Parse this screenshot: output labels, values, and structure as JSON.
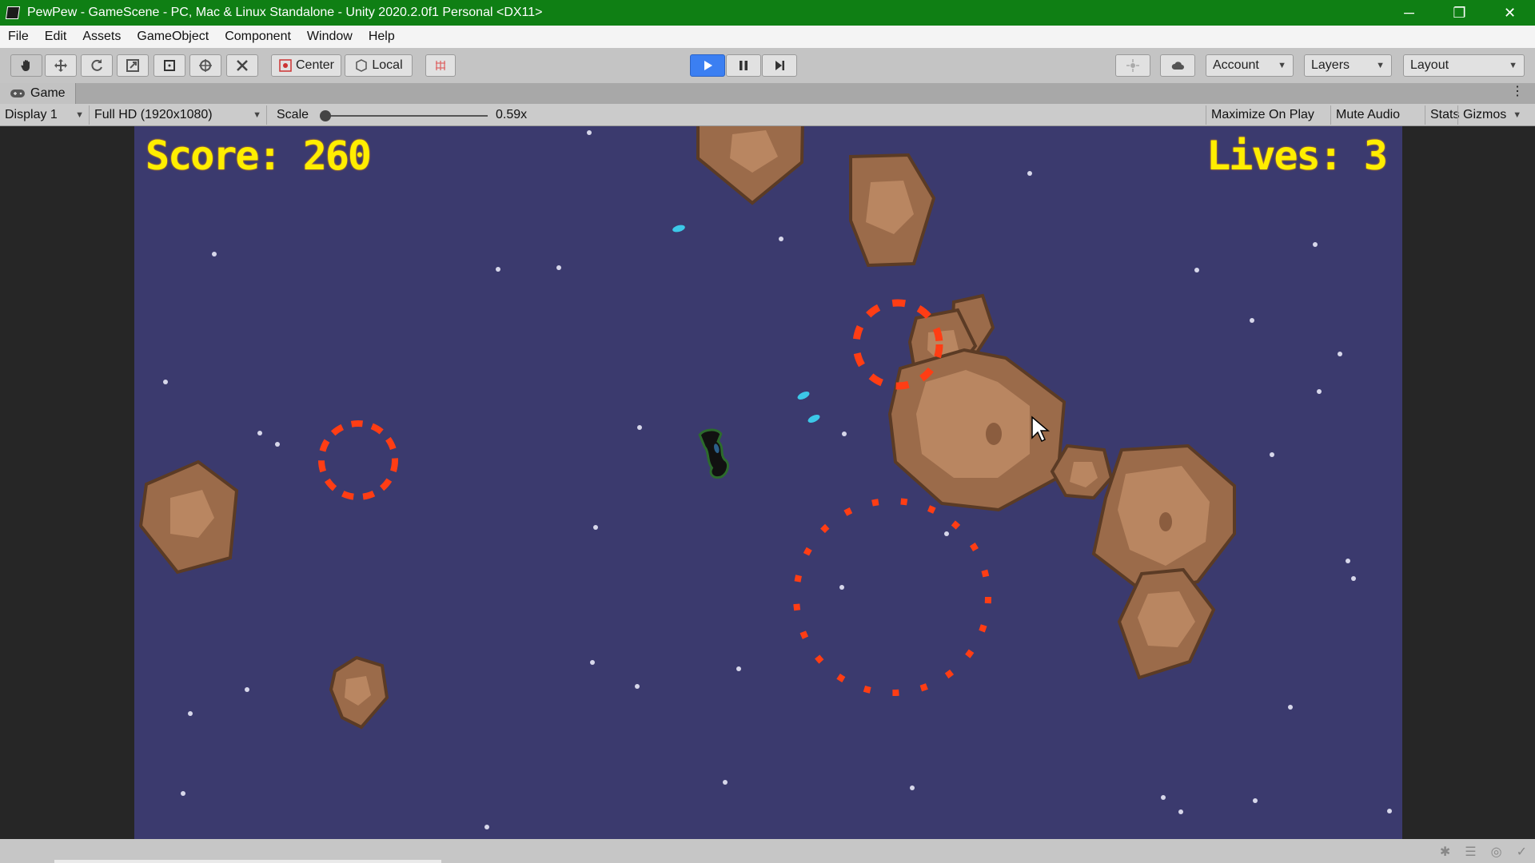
{
  "window": {
    "title": "PewPew - GameScene - PC, Mac & Linux Standalone - Unity 2020.2.0f1 Personal <DX11>",
    "minimize": "─",
    "restore": "❐",
    "close": "✕"
  },
  "menu": [
    "File",
    "Edit",
    "Assets",
    "GameObject",
    "Component",
    "Window",
    "Help"
  ],
  "toolbar": {
    "pivot_label": "Center",
    "space_label": "Local",
    "account_label": "Account",
    "layers_label": "Layers",
    "layout_label": "Layout"
  },
  "game_tab": {
    "label": "Game",
    "display": "Display 1",
    "resolution": "Full HD (1920x1080)",
    "scale_label": "Scale",
    "scale_value": "0.59x",
    "maximize_on_play": "Maximize On Play",
    "mute_audio": "Mute Audio",
    "stats": "Stats",
    "gizmos": "Gizmos"
  },
  "game": {
    "score_text": "Score: 260",
    "lives_text": "Lives: 3"
  },
  "colors": {
    "title_bar": "#0f7f14",
    "game_background": "#3b3a6e",
    "hud_text": "#ffee00",
    "asteroid": "#9b6b4a",
    "explosion": "#ff3d14",
    "bullet": "#3cc8e8",
    "play_button": "#3b7ff2"
  }
}
